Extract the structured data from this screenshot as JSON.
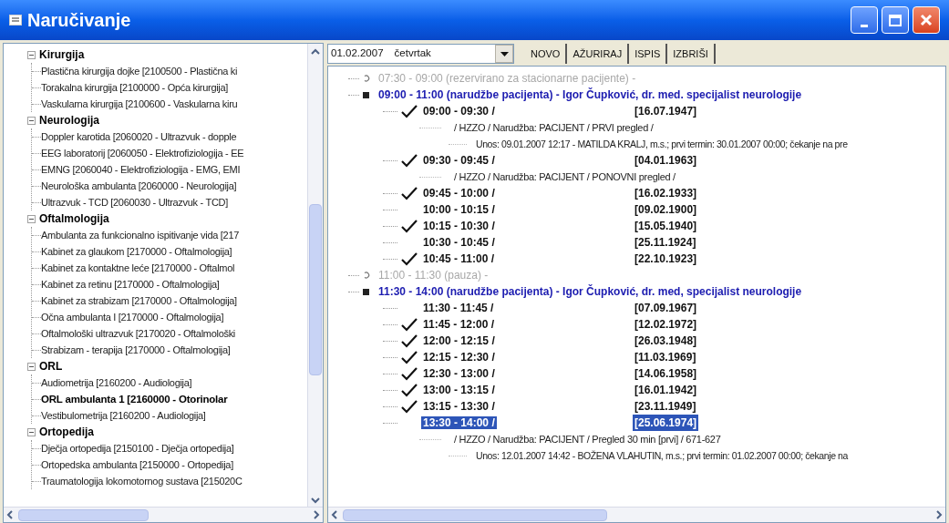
{
  "window": {
    "title": "Naručivanje"
  },
  "departments": [
    {
      "name": "Kirurgija",
      "expanded": true,
      "children": [
        {
          "label": "Plastična kirurgija dojke [2100500 - Plastična ki",
          "bold": false
        },
        {
          "label": "Torakalna kirurgija [2100000 - Opća kirurgija]",
          "bold": false
        },
        {
          "label": "Vaskularna kirurgija [2100600 - Vaskularna kiru",
          "bold": false
        }
      ]
    },
    {
      "name": "Neurologija",
      "expanded": true,
      "children": [
        {
          "label": "Doppler karotida [2060020 - Ultrazvuk - dopple",
          "bold": false
        },
        {
          "label": "EEG laboratorij [2060050 - Elektrofiziologija - EE",
          "bold": false
        },
        {
          "label": "EMNG [2060040 - Elektrofiziologija - EMG, EMI",
          "bold": false
        },
        {
          "label": "Neurološka ambulanta [2060000 - Neurologija]",
          "bold": false
        },
        {
          "label": "Ultrazvuk - TCD [2060030 - Ultrazvuk - TCD]",
          "bold": false
        }
      ]
    },
    {
      "name": "Oftalmologija",
      "expanded": true,
      "children": [
        {
          "label": "Ambulanta za funkcionalno ispitivanje vida [217",
          "bold": false
        },
        {
          "label": "Kabinet za glaukom [2170000 - Oftalmologija]",
          "bold": false
        },
        {
          "label": "Kabinet za kontaktne leće [2170000 - Oftalmol",
          "bold": false
        },
        {
          "label": "Kabinet za retinu [2170000 - Oftalmologija]",
          "bold": false
        },
        {
          "label": "Kabinet za strabizam [2170000 - Oftalmologija]",
          "bold": false
        },
        {
          "label": "Očna ambulanta I [2170000 - Oftalmologija]",
          "bold": false
        },
        {
          "label": "Oftalmološki ultrazvuk [2170020 - Oftalmološki",
          "bold": false
        },
        {
          "label": "Strabizam - terapija [2170000 - Oftalmologija]",
          "bold": false
        }
      ]
    },
    {
      "name": "ORL",
      "expanded": true,
      "children": [
        {
          "label": "Audiometrija [2160200 - Audiologija]",
          "bold": false
        },
        {
          "label": "ORL ambulanta 1 [2160000 - Otorinolar",
          "bold": true
        },
        {
          "label": "Vestibulometrija [2160200 - Audiologija]",
          "bold": false
        }
      ]
    },
    {
      "name": "Ortopedija",
      "expanded": true,
      "children": [
        {
          "label": "Dječja ortopedija [2150100 - Dječja ortopedija]",
          "bold": false
        },
        {
          "label": "Ortopedska ambulanta [2150000 - Ortopedija]",
          "bold": false
        },
        {
          "label": "Traumatologija lokomotornog sustava [215020C",
          "bold": false
        }
      ]
    }
  ],
  "date_picker": {
    "date": "01.02.2007",
    "weekday": "četvrtak"
  },
  "toolbar": [
    "NOVO",
    "AŽURIRAJ",
    "ISPIS",
    "IZBRIŠI"
  ],
  "schedule": [
    {
      "kind": "reserved",
      "label": "07:30 - 09:00 (rezervirano za stacionarne pacijente) -"
    },
    {
      "kind": "booked",
      "label": "09:00 - 11:00 (narudžbe pacijenta) - Igor Čupković, dr. med. specijalist neurologije",
      "appointments": [
        {
          "time": "09:00 - 09:30  /",
          "date": "[16.07.1947]",
          "checked": true,
          "selected": false,
          "details": [
            {
              "text": "/ HZZO  /  Narudžba: PACIJENT  / PRVI pregled  /",
              "children": [
                {
                  "text": "Unos: 09.01.2007 12:17 - MATILDA KRALJ, m.s.; prvi termin: 30.01.2007 00:00; čekanje na pre"
                }
              ]
            }
          ]
        },
        {
          "time": "09:30 - 09:45  /",
          "date": "[04.01.1963]",
          "checked": true,
          "selected": false,
          "details": [
            {
              "text": "/ HZZO  /  Narudžba: PACIJENT  / PONOVNI pregled  /"
            }
          ]
        },
        {
          "time": "09:45 - 10:00  /",
          "date": "[16.02.1933]",
          "checked": true,
          "selected": false
        },
        {
          "time": "10:00 - 10:15  /",
          "date": "[09.02.1900]",
          "checked": false,
          "selected": false
        },
        {
          "time": "10:15 - 10:30  /",
          "date": "[15.05.1940]",
          "checked": true,
          "selected": false
        },
        {
          "time": "10:30 - 10:45  /",
          "date": "[25.11.1924]",
          "checked": false,
          "selected": false
        },
        {
          "time": "10:45 - 11:00  /",
          "date": "[22.10.1923]",
          "checked": true,
          "selected": false
        }
      ]
    },
    {
      "kind": "reserved",
      "label": "11:00 - 11:30 (pauza) -"
    },
    {
      "kind": "booked",
      "label": "11:30 - 14:00 (narudžbe pacijenta) - Igor Čupković, dr. med, specijalist neurologije",
      "appointments": [
        {
          "time": "11:30 - 11:45  /",
          "date": "[07.09.1967]",
          "checked": false,
          "selected": false
        },
        {
          "time": "11:45 - 12:00  /",
          "date": "[12.02.1972]",
          "checked": true,
          "selected": false
        },
        {
          "time": "12:00 - 12:15  /",
          "date": "[26.03.1948]",
          "checked": true,
          "selected": false
        },
        {
          "time": "12:15 - 12:30  /",
          "date": "[11.03.1969]",
          "checked": true,
          "selected": false
        },
        {
          "time": "12:30 - 13:00  /",
          "date": "[14.06.1958]",
          "checked": true,
          "selected": false
        },
        {
          "time": "13:00 - 13:15  /",
          "date": "[16.01.1942]",
          "checked": true,
          "selected": false
        },
        {
          "time": "13:15 - 13:30  /",
          "date": "[23.11.1949]",
          "checked": true,
          "selected": false
        },
        {
          "time": "13:30 - 14:00  /",
          "date": "[25.06.1974]",
          "checked": false,
          "selected": true,
          "details": [
            {
              "text": "/ HZZO  /  Narudžba: PACIJENT  / Pregled 30 min [prvi]  /  671-627",
              "children": [
                {
                  "text": "Unos: 12.01.2007 14:42 - BOŽENA VLAHUTIN, m.s.; prvi termin: 01.02.2007 00:00; čekanje na"
                }
              ]
            }
          ]
        }
      ]
    }
  ]
}
